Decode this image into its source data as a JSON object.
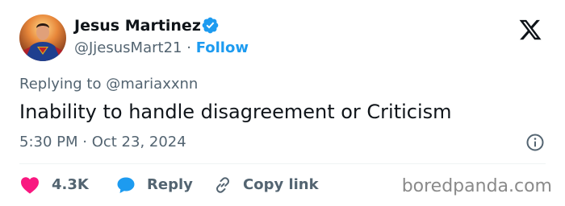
{
  "author": {
    "name": "Jesus Martinez",
    "handle": "@JjesusMart21",
    "separator": "·",
    "follow_label": "Follow",
    "avatar_icon": "superman-avatar",
    "verified_icon": "verified-badge-icon"
  },
  "brand_icon": "x-logo-icon",
  "reply_context": {
    "label": "Replying to @mariaxxnn"
  },
  "tweet": {
    "text": "Inability to handle disagreement or Criticism",
    "timestamp": "5:30 PM · Oct 23, 2024",
    "info_icon": "info-icon"
  },
  "actions": {
    "like_count": "4.3K",
    "reply_label": "Reply",
    "copy_link_label": "Copy link"
  },
  "watermark": "boredpanda.com",
  "colors": {
    "accent": "#1d9bf0",
    "like": "#f91880",
    "text_primary": "#0f1419",
    "text_secondary": "#536471",
    "divider": "#eff3f4"
  }
}
